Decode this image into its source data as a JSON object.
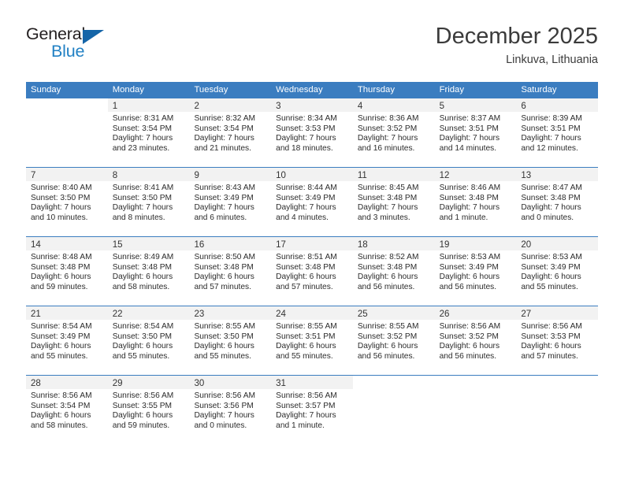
{
  "brand": {
    "name_part1": "General",
    "name_part2": "Blue",
    "flag_icon": "blue-triangle-flag",
    "accent_color": "#2281c4",
    "dark_color": "#231f20"
  },
  "header": {
    "title": "December 2025",
    "subtitle": "Linkuva, Lithuania"
  },
  "calendar": {
    "header_color": "#3b7dc0",
    "daynum_band_color": "#f2f2f2",
    "weekdays": [
      "Sunday",
      "Monday",
      "Tuesday",
      "Wednesday",
      "Thursday",
      "Friday",
      "Saturday"
    ],
    "weeks": [
      [
        {
          "day": "",
          "lines": []
        },
        {
          "day": "1",
          "lines": [
            "Sunrise: 8:31 AM",
            "Sunset: 3:54 PM",
            "Daylight: 7 hours",
            "and 23 minutes."
          ]
        },
        {
          "day": "2",
          "lines": [
            "Sunrise: 8:32 AM",
            "Sunset: 3:54 PM",
            "Daylight: 7 hours",
            "and 21 minutes."
          ]
        },
        {
          "day": "3",
          "lines": [
            "Sunrise: 8:34 AM",
            "Sunset: 3:53 PM",
            "Daylight: 7 hours",
            "and 18 minutes."
          ]
        },
        {
          "day": "4",
          "lines": [
            "Sunrise: 8:36 AM",
            "Sunset: 3:52 PM",
            "Daylight: 7 hours",
            "and 16 minutes."
          ]
        },
        {
          "day": "5",
          "lines": [
            "Sunrise: 8:37 AM",
            "Sunset: 3:51 PM",
            "Daylight: 7 hours",
            "and 14 minutes."
          ]
        },
        {
          "day": "6",
          "lines": [
            "Sunrise: 8:39 AM",
            "Sunset: 3:51 PM",
            "Daylight: 7 hours",
            "and 12 minutes."
          ]
        }
      ],
      [
        {
          "day": "7",
          "lines": [
            "Sunrise: 8:40 AM",
            "Sunset: 3:50 PM",
            "Daylight: 7 hours",
            "and 10 minutes."
          ]
        },
        {
          "day": "8",
          "lines": [
            "Sunrise: 8:41 AM",
            "Sunset: 3:50 PM",
            "Daylight: 7 hours",
            "and 8 minutes."
          ]
        },
        {
          "day": "9",
          "lines": [
            "Sunrise: 8:43 AM",
            "Sunset: 3:49 PM",
            "Daylight: 7 hours",
            "and 6 minutes."
          ]
        },
        {
          "day": "10",
          "lines": [
            "Sunrise: 8:44 AM",
            "Sunset: 3:49 PM",
            "Daylight: 7 hours",
            "and 4 minutes."
          ]
        },
        {
          "day": "11",
          "lines": [
            "Sunrise: 8:45 AM",
            "Sunset: 3:48 PM",
            "Daylight: 7 hours",
            "and 3 minutes."
          ]
        },
        {
          "day": "12",
          "lines": [
            "Sunrise: 8:46 AM",
            "Sunset: 3:48 PM",
            "Daylight: 7 hours",
            "and 1 minute."
          ]
        },
        {
          "day": "13",
          "lines": [
            "Sunrise: 8:47 AM",
            "Sunset: 3:48 PM",
            "Daylight: 7 hours",
            "and 0 minutes."
          ]
        }
      ],
      [
        {
          "day": "14",
          "lines": [
            "Sunrise: 8:48 AM",
            "Sunset: 3:48 PM",
            "Daylight: 6 hours",
            "and 59 minutes."
          ]
        },
        {
          "day": "15",
          "lines": [
            "Sunrise: 8:49 AM",
            "Sunset: 3:48 PM",
            "Daylight: 6 hours",
            "and 58 minutes."
          ]
        },
        {
          "day": "16",
          "lines": [
            "Sunrise: 8:50 AM",
            "Sunset: 3:48 PM",
            "Daylight: 6 hours",
            "and 57 minutes."
          ]
        },
        {
          "day": "17",
          "lines": [
            "Sunrise: 8:51 AM",
            "Sunset: 3:48 PM",
            "Daylight: 6 hours",
            "and 57 minutes."
          ]
        },
        {
          "day": "18",
          "lines": [
            "Sunrise: 8:52 AM",
            "Sunset: 3:48 PM",
            "Daylight: 6 hours",
            "and 56 minutes."
          ]
        },
        {
          "day": "19",
          "lines": [
            "Sunrise: 8:53 AM",
            "Sunset: 3:49 PM",
            "Daylight: 6 hours",
            "and 56 minutes."
          ]
        },
        {
          "day": "20",
          "lines": [
            "Sunrise: 8:53 AM",
            "Sunset: 3:49 PM",
            "Daylight: 6 hours",
            "and 55 minutes."
          ]
        }
      ],
      [
        {
          "day": "21",
          "lines": [
            "Sunrise: 8:54 AM",
            "Sunset: 3:49 PM",
            "Daylight: 6 hours",
            "and 55 minutes."
          ]
        },
        {
          "day": "22",
          "lines": [
            "Sunrise: 8:54 AM",
            "Sunset: 3:50 PM",
            "Daylight: 6 hours",
            "and 55 minutes."
          ]
        },
        {
          "day": "23",
          "lines": [
            "Sunrise: 8:55 AM",
            "Sunset: 3:50 PM",
            "Daylight: 6 hours",
            "and 55 minutes."
          ]
        },
        {
          "day": "24",
          "lines": [
            "Sunrise: 8:55 AM",
            "Sunset: 3:51 PM",
            "Daylight: 6 hours",
            "and 55 minutes."
          ]
        },
        {
          "day": "25",
          "lines": [
            "Sunrise: 8:55 AM",
            "Sunset: 3:52 PM",
            "Daylight: 6 hours",
            "and 56 minutes."
          ]
        },
        {
          "day": "26",
          "lines": [
            "Sunrise: 8:56 AM",
            "Sunset: 3:52 PM",
            "Daylight: 6 hours",
            "and 56 minutes."
          ]
        },
        {
          "day": "27",
          "lines": [
            "Sunrise: 8:56 AM",
            "Sunset: 3:53 PM",
            "Daylight: 6 hours",
            "and 57 minutes."
          ]
        }
      ],
      [
        {
          "day": "28",
          "lines": [
            "Sunrise: 8:56 AM",
            "Sunset: 3:54 PM",
            "Daylight: 6 hours",
            "and 58 minutes."
          ]
        },
        {
          "day": "29",
          "lines": [
            "Sunrise: 8:56 AM",
            "Sunset: 3:55 PM",
            "Daylight: 6 hours",
            "and 59 minutes."
          ]
        },
        {
          "day": "30",
          "lines": [
            "Sunrise: 8:56 AM",
            "Sunset: 3:56 PM",
            "Daylight: 7 hours",
            "and 0 minutes."
          ]
        },
        {
          "day": "31",
          "lines": [
            "Sunrise: 8:56 AM",
            "Sunset: 3:57 PM",
            "Daylight: 7 hours",
            "and 1 minute."
          ]
        },
        {
          "day": "",
          "lines": []
        },
        {
          "day": "",
          "lines": []
        },
        {
          "day": "",
          "lines": []
        }
      ]
    ]
  }
}
